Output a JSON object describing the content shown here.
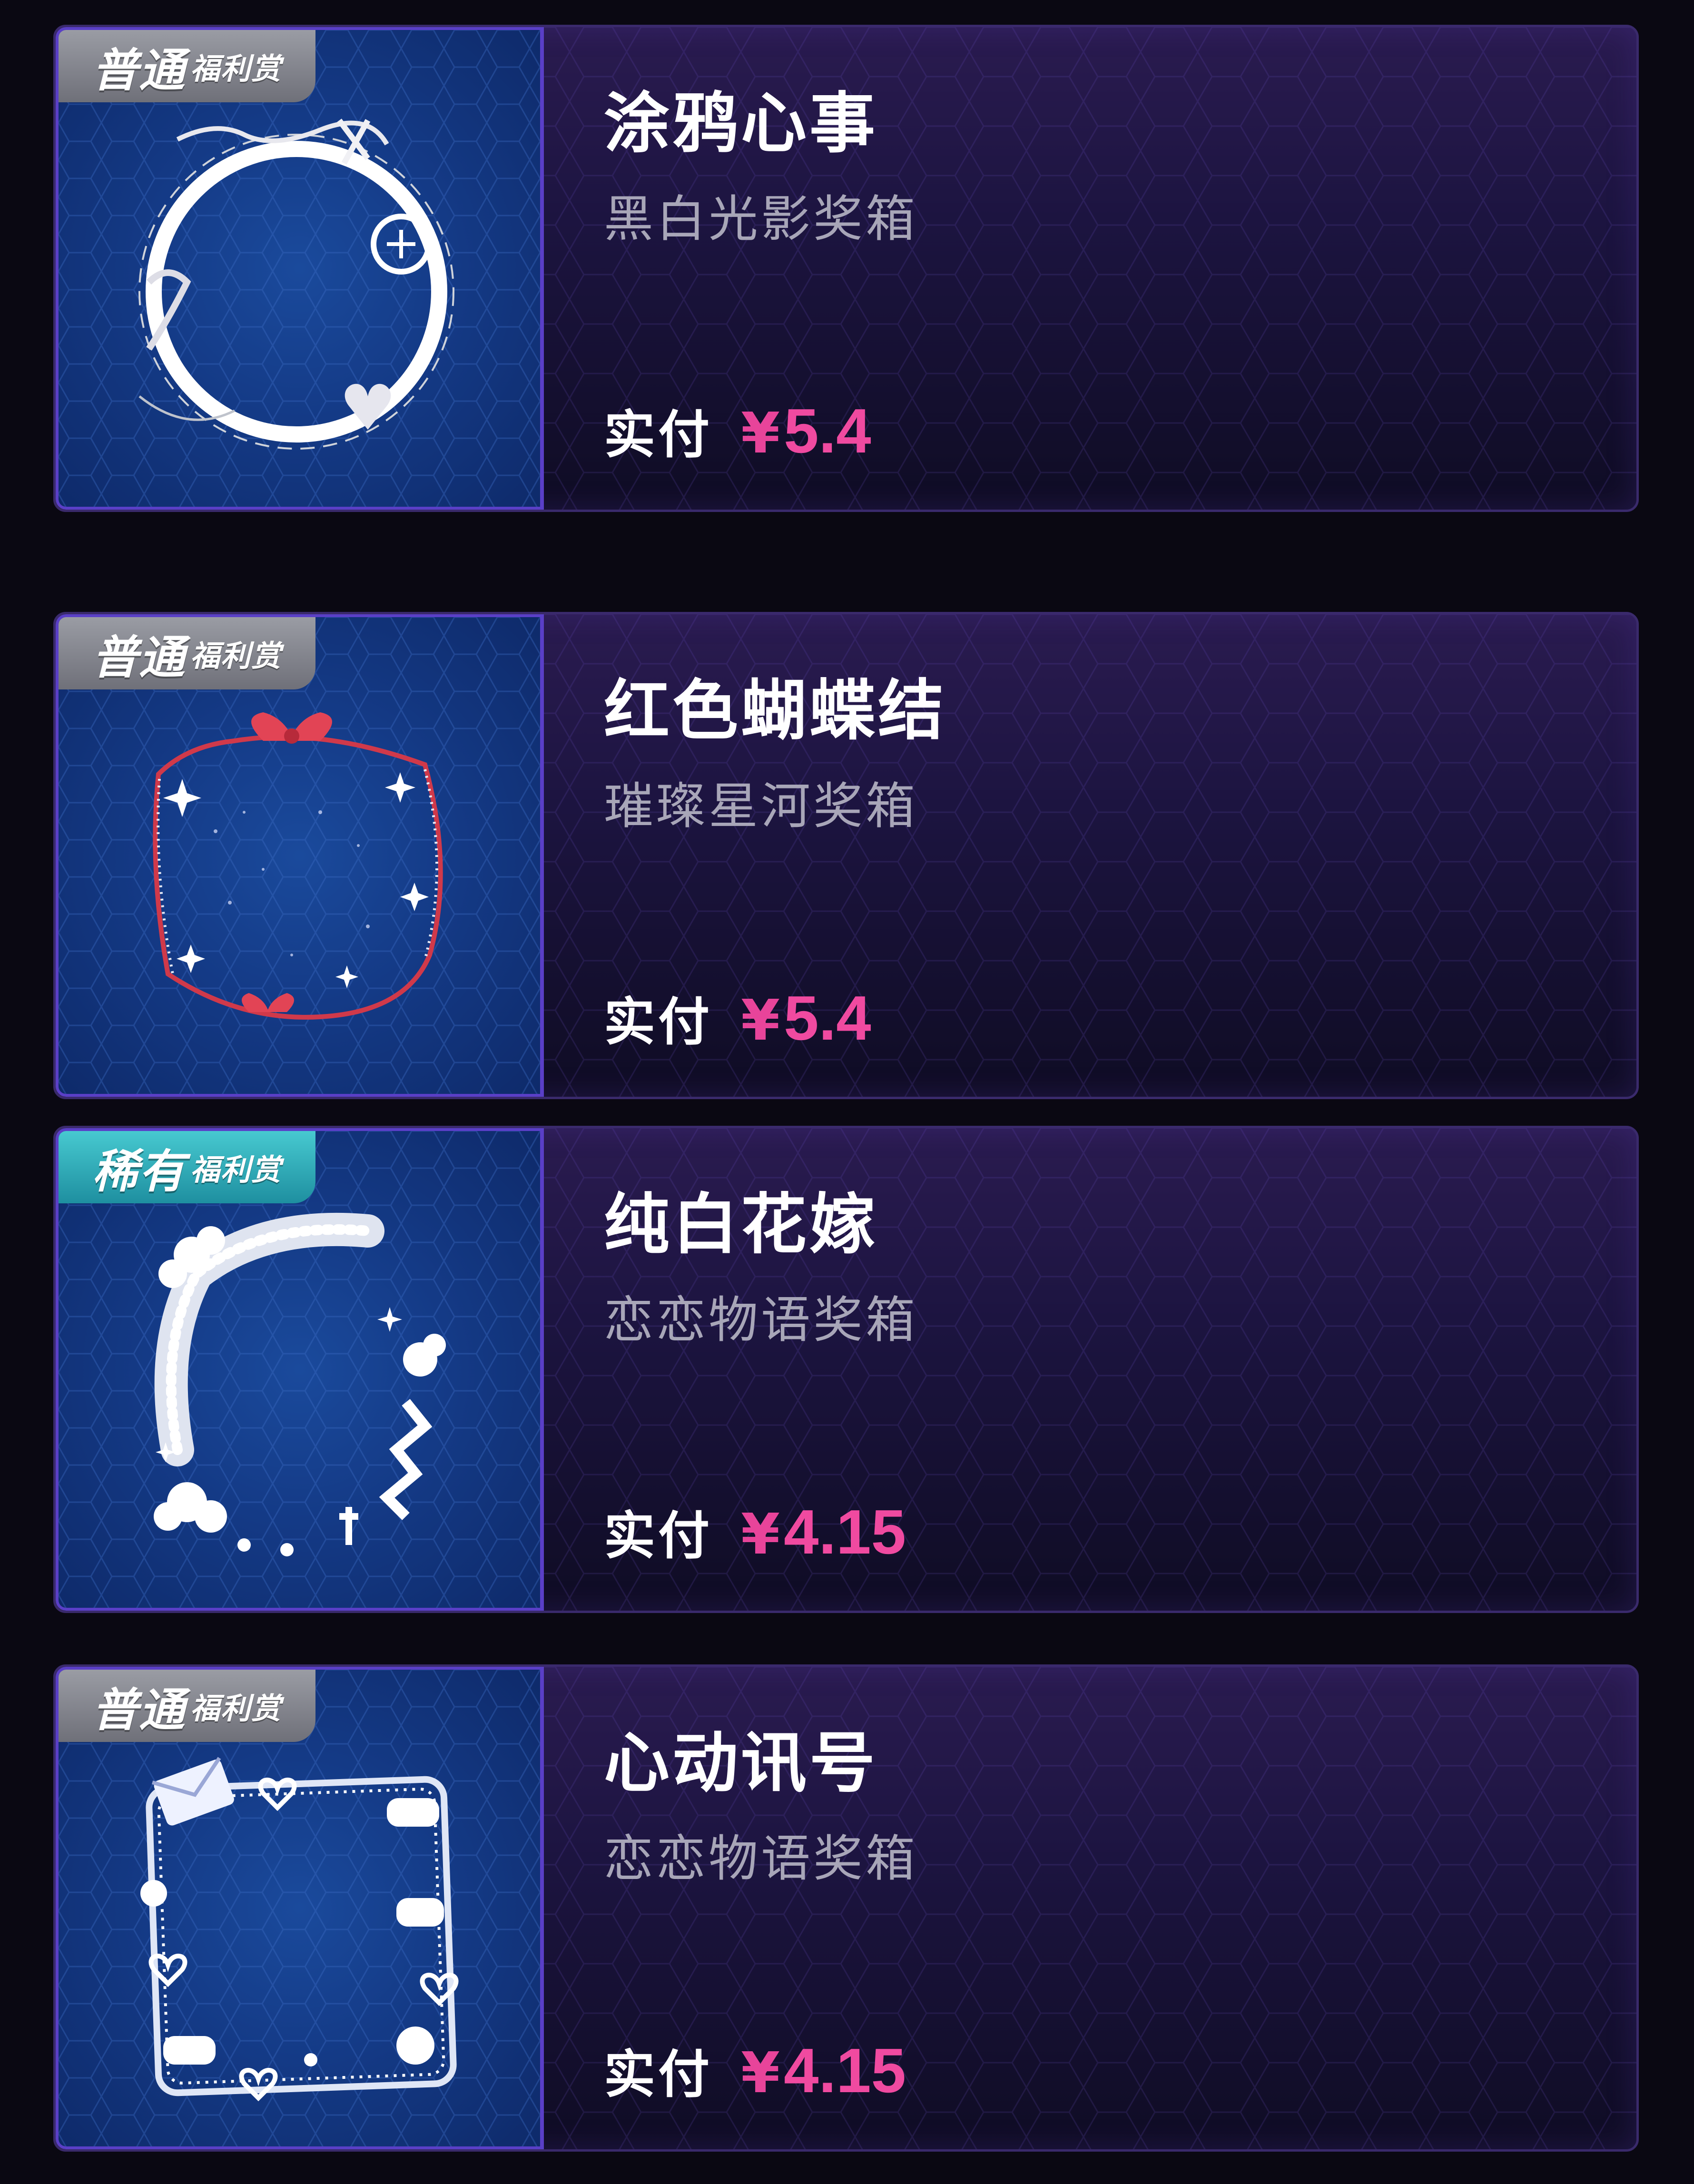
{
  "items": [
    {
      "badge": {
        "main": "普通",
        "sub": "福利赏",
        "tier": "normal",
        "color": "#8a8b93"
      },
      "title": "涂鸦心事",
      "box": "黑白光影奖箱",
      "price_label": "实付",
      "currency": "¥",
      "price": "5.4",
      "art": "graffiti-ring-frame"
    },
    {
      "badge": {
        "main": "普通",
        "sub": "福利赏",
        "tier": "normal",
        "color": "#8a8b93"
      },
      "title": "红色蝴蝶结",
      "box": "璀璨星河奖箱",
      "price_label": "实付",
      "currency": "¥",
      "price": "5.4",
      "art": "red-ribbon-frame"
    },
    {
      "badge": {
        "main": "稀有",
        "sub": "福利赏",
        "tier": "rare",
        "color": "#2fb3c0"
      },
      "title": "纯白花嫁",
      "box": "恋恋物语奖箱",
      "price_label": "实付",
      "currency": "¥",
      "price": "4.15",
      "art": "white-flower-frame"
    },
    {
      "badge": {
        "main": "普通",
        "sub": "福利赏",
        "tier": "normal",
        "color": "#8a8b93"
      },
      "title": "心动讯号",
      "box": "恋恋物语奖箱",
      "price_label": "实付",
      "currency": "¥",
      "price": "4.15",
      "art": "heart-signal-frame"
    }
  ],
  "colors": {
    "background": "#0a0812",
    "price_pink": "#f04aa0",
    "card_border": "#3a2a6c",
    "thumb_blue": "#143a86"
  }
}
